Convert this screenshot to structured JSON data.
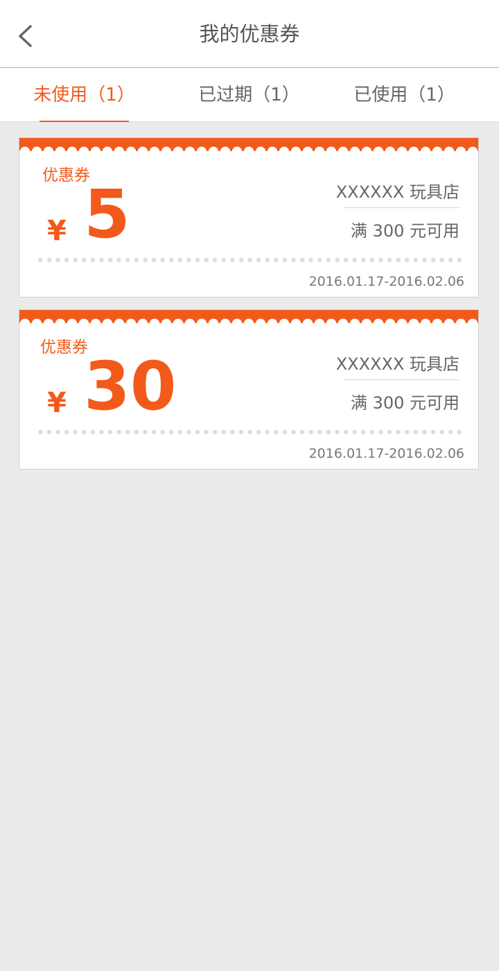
{
  "header": {
    "title": "我的优惠券",
    "back_icon": "chevron-left-icon"
  },
  "tabs": [
    {
      "label": "未使用（1）",
      "active": true
    },
    {
      "label": "已过期（1）",
      "active": false
    },
    {
      "label": "已使用（1）",
      "active": false
    }
  ],
  "colors": {
    "accent": "#f25a1c",
    "background": "#ebebeb"
  },
  "coupons": [
    {
      "label": "优惠券",
      "currency": "¥",
      "amount": "5",
      "shop": "XXXXXX 玩具店",
      "condition": "满 300 元可用",
      "date_range": "2016.01.17-2016.02.06"
    },
    {
      "label": "优惠券",
      "currency": "¥",
      "amount": "30",
      "shop": "XXXXXX 玩具店",
      "condition": "满 300 元可用",
      "date_range": "2016.01.17-2016.02.06"
    }
  ]
}
